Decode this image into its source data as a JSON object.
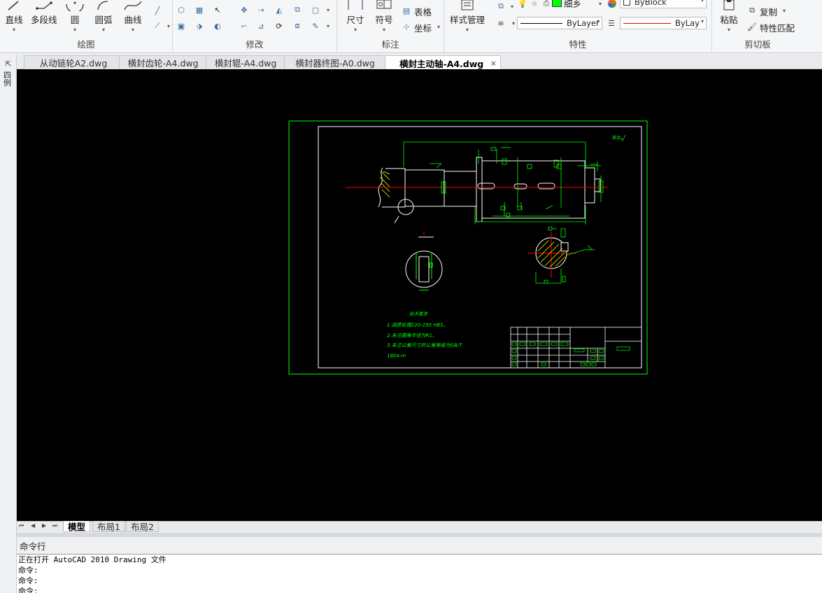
{
  "ribbon": {
    "draw": {
      "title": "绘图",
      "buttons": [
        {
          "label": "直线",
          "icon": "line-icon"
        },
        {
          "label": "多段线",
          "icon": "polyline-icon"
        },
        {
          "label": "圆",
          "icon": "circle-icon"
        },
        {
          "label": "圆弧",
          "icon": "arc-icon"
        },
        {
          "label": "曲线",
          "icon": "spline-icon"
        }
      ]
    },
    "modify": {
      "title": "修改"
    },
    "annotate": {
      "title": "标注",
      "dimension_label": "尺寸",
      "symbol_label": "符号",
      "table_label": "表格",
      "coordinate_label": "坐标"
    },
    "properties": {
      "title": "特性",
      "style_manager_label": "样式管理",
      "lineweight_value": "细乡",
      "byblock_value": "ByBlock",
      "linetype_value": "ByLayer",
      "linecolor_value": "ByLay",
      "color_swatch": "#00ff00"
    },
    "clipboard": {
      "title": "剪切板",
      "paste_label": "粘贴",
      "copy_label": "复制",
      "match_label": "特性匹配"
    }
  },
  "sidebar": {
    "label": "四例"
  },
  "tabs": [
    {
      "label": "从动链轮A2.dwg",
      "active": false
    },
    {
      "label": "横封齿轮-A4.dwg",
      "active": false
    },
    {
      "label": "横封辊-A4.dwg",
      "active": false
    },
    {
      "label": "横封器终图-A0.dwg",
      "active": false
    },
    {
      "label": "横封主动轴-A4.dwg",
      "active": true
    }
  ],
  "tab_close": "×",
  "drawing": {
    "notes_title": "技术要求",
    "notes": [
      "1.调质处理220-250 HBS。",
      "2.未注圆角半径为R1。",
      "3.未注公差尺寸的公差等级为GB/T",
      "1804-m"
    ],
    "frame_color": "#00ff00",
    "centerline_color": "#ff0000"
  },
  "layout_tabs": [
    {
      "label": "模型",
      "active": true
    },
    {
      "label": "布局1",
      "active": false
    },
    {
      "label": "布局2",
      "active": false
    }
  ],
  "command": {
    "title": "命令行",
    "lines": [
      "正在打开 AutoCAD 2010 Drawing 文件",
      "命令:",
      "命令:",
      "命令:"
    ]
  }
}
